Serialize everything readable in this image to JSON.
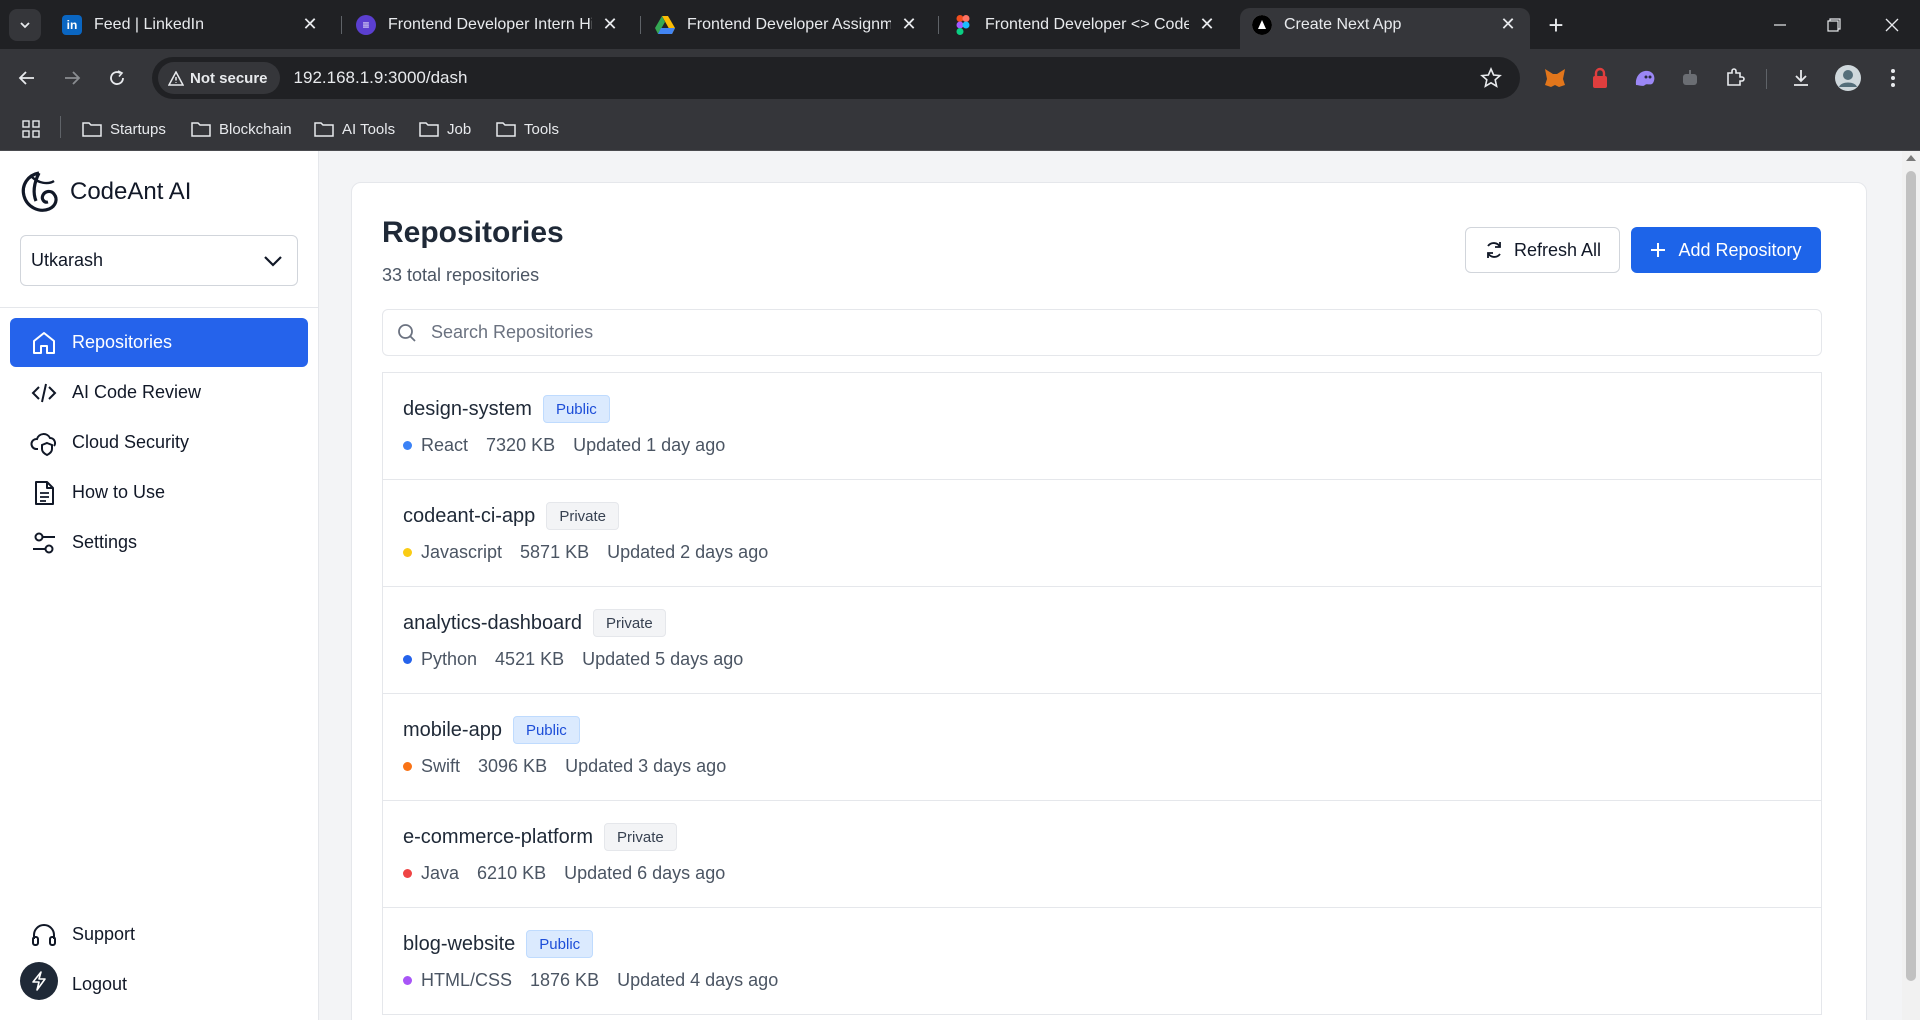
{
  "browser": {
    "tabs": [
      {
        "title": "Feed | LinkedIn",
        "favicon": "linkedin-icon",
        "color": "#0a66c2"
      },
      {
        "title": "Frontend Developer Intern Hiring",
        "favicon": "form-icon",
        "color": "#7c4dff"
      },
      {
        "title": "Frontend Developer Assignment",
        "favicon": "google-drive-icon",
        "color": "#34a853"
      },
      {
        "title": "Frontend Developer <> CodeAnt",
        "favicon": "figma-icon",
        "color": "#f24e1e"
      },
      {
        "title": "Create Next App",
        "favicon": "nextjs-icon",
        "color": "#000000"
      }
    ],
    "security_label": "Not secure",
    "url": "192.168.1.9:3000/dash",
    "bookmarks": [
      "Startups",
      "Blockchain",
      "AI Tools",
      "Job",
      "Tools"
    ]
  },
  "sidebar": {
    "brand": "CodeAnt AI",
    "org": "Utkarash",
    "items": [
      {
        "label": "Repositories",
        "icon": "home-icon",
        "active": true
      },
      {
        "label": "AI Code Review",
        "icon": "code-icon",
        "active": false
      },
      {
        "label": "Cloud Security",
        "icon": "cloud-security-icon",
        "active": false
      },
      {
        "label": "How to Use",
        "icon": "document-icon",
        "active": false
      },
      {
        "label": "Settings",
        "icon": "settings-sliders-icon",
        "active": false
      }
    ],
    "footer": [
      {
        "label": "Support",
        "icon": "headphones-icon"
      },
      {
        "label": "Logout",
        "icon": "logout-icon"
      }
    ]
  },
  "main": {
    "title": "Repositories",
    "subtitle": "33 total repositories",
    "refresh_label": "Refresh All",
    "add_label": "Add Repository",
    "search_placeholder": "Search Repositories",
    "accent": "#1d64e9",
    "repos": [
      {
        "name": "design-system",
        "visibility": "Public",
        "language": "React",
        "lang_color": "#3b82f6",
        "size": "7320 KB",
        "updated": "Updated 1 day ago"
      },
      {
        "name": "codeant-ci-app",
        "visibility": "Private",
        "language": "Javascript",
        "lang_color": "#facc15",
        "size": "5871 KB",
        "updated": "Updated 2 days ago"
      },
      {
        "name": "analytics-dashboard",
        "visibility": "Private",
        "language": "Python",
        "lang_color": "#2563eb",
        "size": "4521 KB",
        "updated": "Updated 5 days ago"
      },
      {
        "name": "mobile-app",
        "visibility": "Public",
        "language": "Swift",
        "lang_color": "#f97316",
        "size": "3096 KB",
        "updated": "Updated 3 days ago"
      },
      {
        "name": "e-commerce-platform",
        "visibility": "Private",
        "language": "Java",
        "lang_color": "#ef4444",
        "size": "6210 KB",
        "updated": "Updated 6 days ago"
      },
      {
        "name": "blog-website",
        "visibility": "Public",
        "language": "HTML/CSS",
        "lang_color": "#a855f7",
        "size": "1876 KB",
        "updated": "Updated 4 days ago"
      }
    ]
  }
}
